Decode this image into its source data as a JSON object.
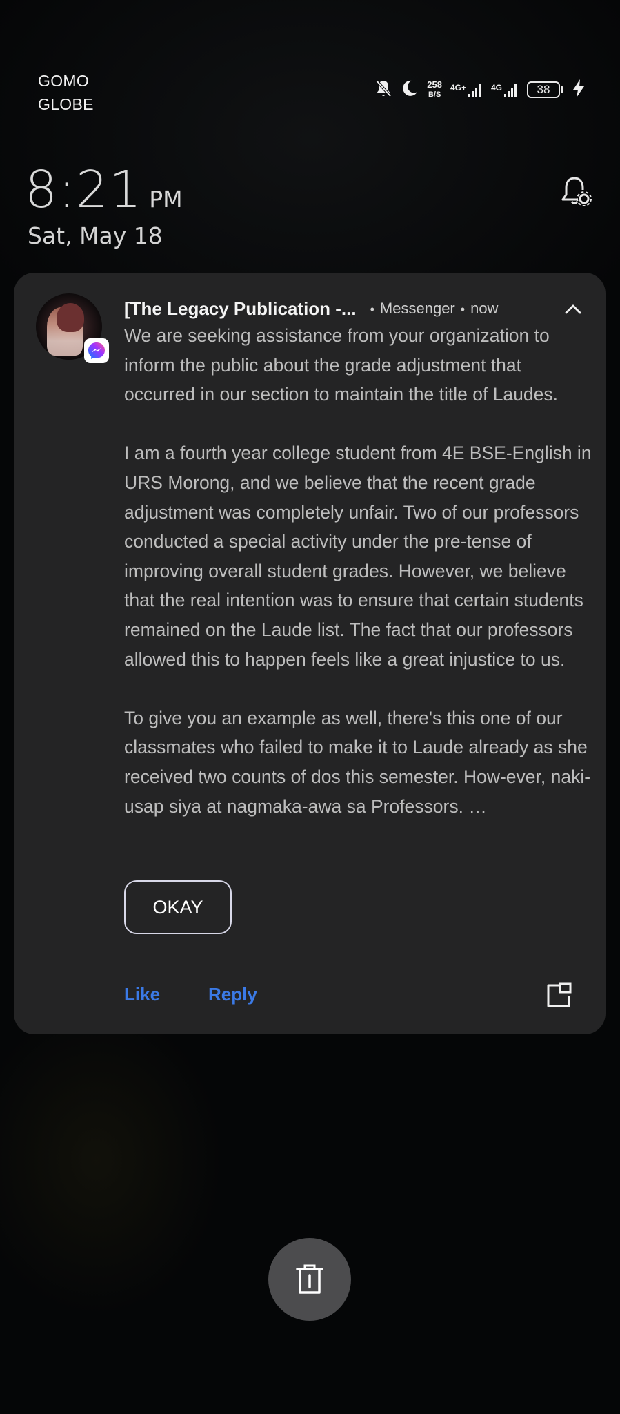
{
  "status_bar": {
    "carrier_line1": "GOMO",
    "carrier_line2": "GLOBE",
    "net_speed_value": "258",
    "net_speed_unit": "B/S",
    "network1": "4G+",
    "network2": "4G",
    "battery": "38",
    "icons": [
      "mute-bell-icon",
      "moon-icon",
      "signal-icon",
      "signal-icon",
      "battery-icon",
      "charging-icon"
    ]
  },
  "lockscreen": {
    "time": "8:21",
    "ampm": "PM",
    "date": "Sat, May 18"
  },
  "notification": {
    "sender": "[The Legacy Publication -...",
    "app": "Messenger",
    "timestamp": "now",
    "paragraphs": [
      "We are seeking assistance from your organization to inform the public about the grade adjustment that occurred in our section to maintain the title of Laudes.",
      "I am a fourth year college student from 4E BSE-English in URS Morong, and we believe that the recent grade adjustment was completely unfair. Two of our professors conducted a special activity under the pre-tense of improving overall student grades. However, we believe that the real intention was to ensure that certain students remained on the Laude list. The fact that our professors allowed this to happen feels like a great injustice to us.",
      "To give you an example as well, there's this one of our classmates who failed to make it to Laude already as she received two counts of dos this semester. How-ever, naki-usap siya at nagmaka-awa sa Professors. …"
    ],
    "okay_label": "OKAY",
    "like_label": "Like",
    "reply_label": "Reply",
    "colors": {
      "card_bg": "#242425",
      "action_blue": "#3b7ae6",
      "messenger_gradient": [
        "#0a7cff",
        "#a033ff",
        "#ff5c87"
      ]
    }
  }
}
